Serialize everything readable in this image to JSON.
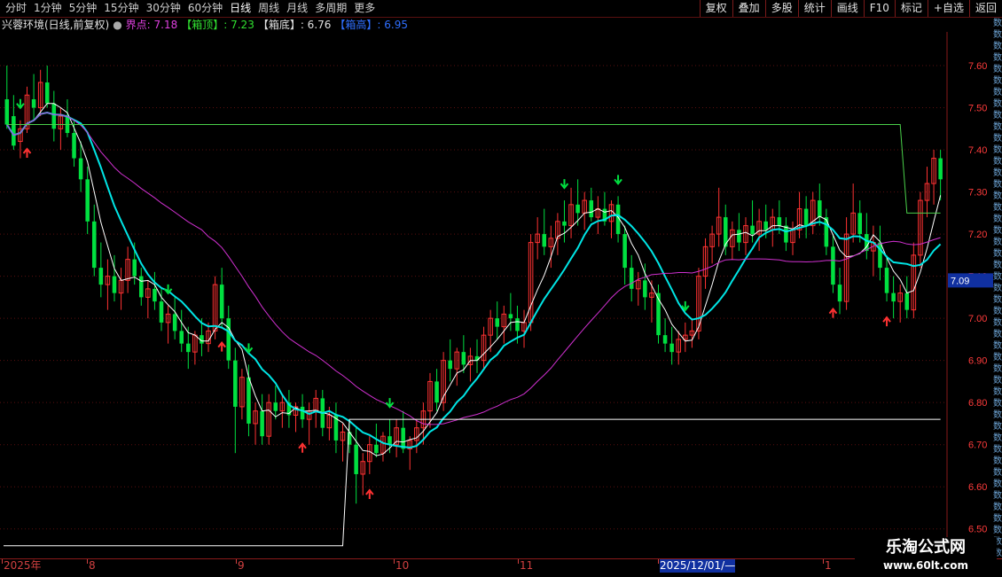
{
  "toolbar": {
    "periods": [
      "分时",
      "1分钟",
      "5分钟",
      "15分钟",
      "30分钟",
      "60分钟",
      "日线",
      "周线",
      "月线",
      "多周期",
      "更多"
    ],
    "active_period": "日线",
    "tools": [
      "复权",
      "叠加",
      "多股",
      "统计",
      "画线",
      "F10",
      "标记",
      "+自选",
      "返回"
    ]
  },
  "legend": {
    "title": "兴蓉环境(日线,前复权)",
    "dot": "●",
    "jiedian": "界点: 7.18",
    "xiangding": "【箱顶】: 7.23",
    "xiangdi": "【箱底】: 6.76",
    "xianggao": "【箱高】: 6.95"
  },
  "colors": {
    "up": "#ff3232",
    "down": "#00e040",
    "ma_fast": "#ffffff",
    "ma_mid": "#00e5e5",
    "ma_slow": "#d030d0",
    "grid": "#5a0f0f",
    "axis_text": "#ff3b3b",
    "price_box": "#1030a0",
    "box_top": "#4ad04a",
    "box_bottom": "#ffffff"
  },
  "right_strip": [
    "数",
    "数",
    "数",
    "数",
    "数",
    "数",
    "数",
    "数",
    "数",
    "数",
    "数",
    "数",
    "数",
    "数",
    "数",
    "数",
    "数",
    "数",
    "数",
    "数",
    "数",
    "数",
    "数",
    "数",
    "数",
    "数",
    "数",
    "数",
    "数",
    "数",
    "数",
    "数",
    "数",
    "数",
    "数",
    "数",
    "数",
    "数",
    "数",
    "数",
    "数",
    "数",
    "数",
    "数",
    "数",
    "数",
    "数"
  ],
  "chart_data": {
    "type": "candlestick",
    "ylim": [
      6.43,
      7.68
    ],
    "y_ticks": [
      "7.60",
      "7.50",
      "7.40",
      "7.30",
      "7.20",
      "7.10",
      "7.00",
      "6.90",
      "6.80",
      "6.70",
      "6.60",
      "6.50"
    ],
    "x_labels": [
      "2025年",
      "8",
      "9",
      "10",
      "11",
      "2025/12/01/—",
      "1"
    ],
    "current_price": "7.09",
    "ohlc": [
      [
        7.52,
        7.6,
        7.45,
        7.46
      ],
      [
        7.48,
        7.53,
        7.4,
        7.41
      ],
      [
        7.42,
        7.47,
        7.38,
        7.45
      ],
      [
        7.45,
        7.55,
        7.44,
        7.53
      ],
      [
        7.52,
        7.58,
        7.47,
        7.5
      ],
      [
        7.5,
        7.59,
        7.48,
        7.56
      ],
      [
        7.56,
        7.6,
        7.5,
        7.51
      ],
      [
        7.51,
        7.54,
        7.42,
        7.45
      ],
      [
        7.45,
        7.5,
        7.4,
        7.48
      ],
      [
        7.48,
        7.52,
        7.43,
        7.44
      ],
      [
        7.44,
        7.47,
        7.36,
        7.38
      ],
      [
        7.38,
        7.42,
        7.3,
        7.33
      ],
      [
        7.33,
        7.36,
        7.2,
        7.23
      ],
      [
        7.23,
        7.27,
        7.1,
        7.12
      ],
      [
        7.12,
        7.18,
        7.05,
        7.08
      ],
      [
        7.08,
        7.14,
        7.02,
        7.1
      ],
      [
        7.1,
        7.15,
        7.04,
        7.06
      ],
      [
        7.06,
        7.12,
        7.02,
        7.09
      ],
      [
        7.09,
        7.17,
        7.06,
        7.14
      ],
      [
        7.14,
        7.18,
        7.08,
        7.1
      ],
      [
        7.1,
        7.12,
        7.03,
        7.05
      ],
      [
        7.05,
        7.09,
        7.0,
        7.07
      ],
      [
        7.07,
        7.11,
        7.02,
        7.04
      ],
      [
        7.04,
        7.07,
        6.97,
        6.99
      ],
      [
        6.99,
        7.03,
        6.94,
        7.01
      ],
      [
        7.01,
        7.05,
        6.95,
        6.97
      ],
      [
        6.97,
        7.02,
        6.92,
        6.94
      ],
      [
        6.94,
        6.98,
        6.88,
        6.92
      ],
      [
        6.92,
        6.97,
        6.89,
        6.96
      ],
      [
        6.96,
        7.0,
        6.91,
        6.94
      ],
      [
        6.94,
        6.99,
        6.92,
        6.97
      ],
      [
        6.97,
        7.1,
        6.95,
        7.08
      ],
      [
        7.08,
        7.12,
        6.98,
        7.0
      ],
      [
        7.0,
        7.03,
        6.88,
        6.9
      ],
      [
        6.9,
        6.93,
        6.68,
        6.79
      ],
      [
        6.79,
        6.88,
        6.76,
        6.86
      ],
      [
        6.86,
        6.89,
        6.72,
        6.75
      ],
      [
        6.75,
        6.8,
        6.7,
        6.78
      ],
      [
        6.78,
        6.82,
        6.7,
        6.72
      ],
      [
        6.72,
        6.82,
        6.7,
        6.8
      ],
      [
        6.8,
        6.84,
        6.76,
        6.78
      ],
      [
        6.78,
        6.82,
        6.74,
        6.8
      ],
      [
        6.8,
        6.83,
        6.74,
        6.77
      ],
      [
        6.77,
        6.8,
        6.73,
        6.79
      ],
      [
        6.79,
        6.82,
        6.74,
        6.76
      ],
      [
        6.76,
        6.8,
        6.7,
        6.78
      ],
      [
        6.78,
        6.83,
        6.74,
        6.81
      ],
      [
        6.81,
        6.83,
        6.72,
        6.74
      ],
      [
        6.74,
        6.79,
        6.71,
        6.77
      ],
      [
        6.77,
        6.8,
        6.68,
        6.71
      ],
      [
        6.71,
        6.75,
        6.66,
        6.73
      ],
      [
        6.73,
        6.76,
        6.68,
        6.7
      ],
      [
        6.7,
        6.74,
        6.56,
        6.63
      ],
      [
        6.63,
        6.68,
        6.58,
        6.66
      ],
      [
        6.66,
        6.72,
        6.63,
        6.7
      ],
      [
        6.7,
        6.75,
        6.67,
        6.68
      ],
      [
        6.68,
        6.73,
        6.66,
        6.72
      ],
      [
        6.72,
        6.76,
        6.68,
        6.7
      ],
      [
        6.7,
        6.76,
        6.67,
        6.74
      ],
      [
        6.74,
        6.78,
        6.68,
        6.69
      ],
      [
        6.69,
        6.72,
        6.64,
        6.71
      ],
      [
        6.71,
        6.76,
        6.68,
        6.74
      ],
      [
        6.74,
        6.8,
        6.7,
        6.78
      ],
      [
        6.78,
        6.87,
        6.74,
        6.85
      ],
      [
        6.85,
        6.88,
        6.78,
        6.8
      ],
      [
        6.8,
        6.92,
        6.78,
        6.9
      ],
      [
        6.9,
        6.95,
        6.85,
        6.88
      ],
      [
        6.88,
        6.93,
        6.84,
        6.92
      ],
      [
        6.92,
        6.96,
        6.87,
        6.89
      ],
      [
        6.89,
        6.93,
        6.85,
        6.91
      ],
      [
        6.91,
        6.95,
        6.87,
        6.9
      ],
      [
        6.9,
        6.98,
        6.88,
        6.96
      ],
      [
        6.96,
        7.02,
        6.92,
        7.0
      ],
      [
        7.0,
        7.04,
        6.95,
        6.98
      ],
      [
        6.98,
        7.03,
        6.94,
        7.01
      ],
      [
        7.01,
        7.06,
        6.97,
        7.0
      ],
      [
        7.0,
        7.03,
        6.94,
        6.97
      ],
      [
        6.97,
        7.02,
        6.93,
        6.99
      ],
      [
        6.99,
        7.2,
        6.97,
        7.18
      ],
      [
        7.18,
        7.24,
        7.14,
        7.2
      ],
      [
        7.2,
        7.26,
        7.15,
        7.17
      ],
      [
        7.17,
        7.22,
        7.12,
        7.19
      ],
      [
        7.19,
        7.25,
        7.15,
        7.23
      ],
      [
        7.23,
        7.28,
        7.18,
        7.22
      ],
      [
        7.22,
        7.31,
        7.19,
        7.27
      ],
      [
        7.27,
        7.33,
        7.22,
        7.25
      ],
      [
        7.25,
        7.3,
        7.21,
        7.28
      ],
      [
        7.28,
        7.31,
        7.23,
        7.24
      ],
      [
        7.24,
        7.29,
        7.2,
        7.26
      ],
      [
        7.26,
        7.3,
        7.22,
        7.23
      ],
      [
        7.23,
        7.28,
        7.19,
        7.27
      ],
      [
        7.27,
        7.29,
        7.18,
        7.2
      ],
      [
        7.2,
        7.22,
        7.08,
        7.12
      ],
      [
        7.12,
        7.15,
        7.04,
        7.07
      ],
      [
        7.07,
        7.11,
        7.03,
        7.09
      ],
      [
        7.09,
        7.13,
        7.02,
        7.05
      ],
      [
        7.05,
        7.09,
        6.99,
        7.06
      ],
      [
        7.06,
        7.08,
        6.94,
        6.96
      ],
      [
        6.96,
        7.0,
        6.92,
        6.94
      ],
      [
        6.94,
        6.98,
        6.89,
        6.92
      ],
      [
        6.92,
        6.97,
        6.89,
        6.95
      ],
      [
        6.95,
        6.99,
        6.92,
        6.96
      ],
      [
        6.96,
        7.0,
        6.93,
        6.97
      ],
      [
        6.97,
        7.12,
        6.95,
        7.1
      ],
      [
        7.1,
        7.19,
        7.07,
        7.17
      ],
      [
        7.17,
        7.22,
        7.13,
        7.2
      ],
      [
        7.2,
        7.31,
        7.17,
        7.24
      ],
      [
        7.24,
        7.27,
        7.15,
        7.17
      ],
      [
        7.17,
        7.23,
        7.14,
        7.21
      ],
      [
        7.21,
        7.25,
        7.16,
        7.18
      ],
      [
        7.18,
        7.24,
        7.15,
        7.22
      ],
      [
        7.22,
        7.28,
        7.18,
        7.2
      ],
      [
        7.2,
        7.26,
        7.16,
        7.23
      ],
      [
        7.23,
        7.27,
        7.19,
        7.21
      ],
      [
        7.21,
        7.26,
        7.17,
        7.24
      ],
      [
        7.24,
        7.28,
        7.2,
        7.22
      ],
      [
        7.22,
        7.24,
        7.16,
        7.18
      ],
      [
        7.18,
        7.23,
        7.15,
        7.21
      ],
      [
        7.21,
        7.3,
        7.19,
        7.26
      ],
      [
        7.26,
        7.29,
        7.19,
        7.22
      ],
      [
        7.22,
        7.3,
        7.2,
        7.28
      ],
      [
        7.28,
        7.32,
        7.22,
        7.24
      ],
      [
        7.24,
        7.26,
        7.15,
        7.17
      ],
      [
        7.17,
        7.2,
        7.06,
        7.08
      ],
      [
        7.08,
        7.12,
        7.01,
        7.04
      ],
      [
        7.04,
        7.24,
        7.02,
        7.2
      ],
      [
        7.2,
        7.32,
        7.18,
        7.25
      ],
      [
        7.25,
        7.28,
        7.18,
        7.2
      ],
      [
        7.2,
        7.25,
        7.14,
        7.16
      ],
      [
        7.16,
        7.22,
        7.1,
        7.18
      ],
      [
        7.18,
        7.22,
        7.09,
        7.12
      ],
      [
        7.12,
        7.15,
        7.04,
        7.06
      ],
      [
        7.06,
        7.1,
        7.0,
        7.04
      ],
      [
        7.04,
        7.08,
        6.99,
        7.06
      ],
      [
        7.06,
        7.1,
        7.0,
        7.02
      ],
      [
        7.02,
        7.18,
        7.0,
        7.15
      ],
      [
        7.15,
        7.3,
        7.12,
        7.28
      ],
      [
        7.28,
        7.36,
        7.24,
        7.32
      ],
      [
        7.32,
        7.4,
        7.27,
        7.38
      ],
      [
        7.38,
        7.4,
        7.28,
        7.33
      ]
    ],
    "box_top_level": 7.46,
    "box_bottom_level": 6.76
  },
  "watermark": {
    "line1": "乐淘公式网",
    "line2": "www.60lt.com"
  }
}
